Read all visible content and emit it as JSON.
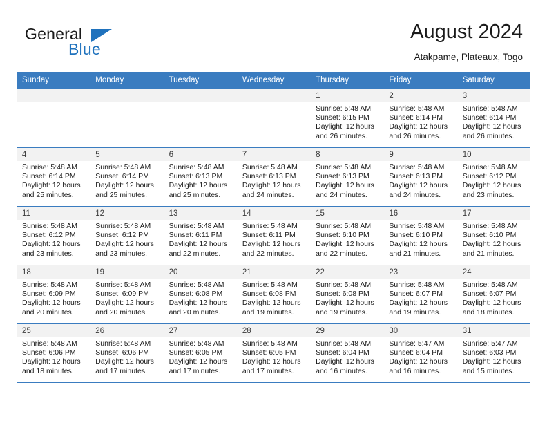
{
  "brand": {
    "word1": "General",
    "word2": "Blue",
    "flag_icon": "triangle-flag-icon"
  },
  "header": {
    "title": "August 2024",
    "subtitle": "Atakpame, Plateaux, Togo"
  },
  "colors": {
    "header_blue": "#3a7cc0",
    "brand_blue": "#1f72bd",
    "row_shade": "#f2f2f2",
    "text": "#1b1b1b"
  },
  "calendar": {
    "weekdays": [
      "Sunday",
      "Monday",
      "Tuesday",
      "Wednesday",
      "Thursday",
      "Friday",
      "Saturday"
    ],
    "weeks": [
      [
        {
          "day": "",
          "sunrise": "",
          "sunset": "",
          "daylight1": "",
          "daylight2": ""
        },
        {
          "day": "",
          "sunrise": "",
          "sunset": "",
          "daylight1": "",
          "daylight2": ""
        },
        {
          "day": "",
          "sunrise": "",
          "sunset": "",
          "daylight1": "",
          "daylight2": ""
        },
        {
          "day": "",
          "sunrise": "",
          "sunset": "",
          "daylight1": "",
          "daylight2": ""
        },
        {
          "day": "1",
          "sunrise": "Sunrise: 5:48 AM",
          "sunset": "Sunset: 6:15 PM",
          "daylight1": "Daylight: 12 hours",
          "daylight2": "and 26 minutes."
        },
        {
          "day": "2",
          "sunrise": "Sunrise: 5:48 AM",
          "sunset": "Sunset: 6:14 PM",
          "daylight1": "Daylight: 12 hours",
          "daylight2": "and 26 minutes."
        },
        {
          "day": "3",
          "sunrise": "Sunrise: 5:48 AM",
          "sunset": "Sunset: 6:14 PM",
          "daylight1": "Daylight: 12 hours",
          "daylight2": "and 26 minutes."
        }
      ],
      [
        {
          "day": "4",
          "sunrise": "Sunrise: 5:48 AM",
          "sunset": "Sunset: 6:14 PM",
          "daylight1": "Daylight: 12 hours",
          "daylight2": "and 25 minutes."
        },
        {
          "day": "5",
          "sunrise": "Sunrise: 5:48 AM",
          "sunset": "Sunset: 6:14 PM",
          "daylight1": "Daylight: 12 hours",
          "daylight2": "and 25 minutes."
        },
        {
          "day": "6",
          "sunrise": "Sunrise: 5:48 AM",
          "sunset": "Sunset: 6:13 PM",
          "daylight1": "Daylight: 12 hours",
          "daylight2": "and 25 minutes."
        },
        {
          "day": "7",
          "sunrise": "Sunrise: 5:48 AM",
          "sunset": "Sunset: 6:13 PM",
          "daylight1": "Daylight: 12 hours",
          "daylight2": "and 24 minutes."
        },
        {
          "day": "8",
          "sunrise": "Sunrise: 5:48 AM",
          "sunset": "Sunset: 6:13 PM",
          "daylight1": "Daylight: 12 hours",
          "daylight2": "and 24 minutes."
        },
        {
          "day": "9",
          "sunrise": "Sunrise: 5:48 AM",
          "sunset": "Sunset: 6:13 PM",
          "daylight1": "Daylight: 12 hours",
          "daylight2": "and 24 minutes."
        },
        {
          "day": "10",
          "sunrise": "Sunrise: 5:48 AM",
          "sunset": "Sunset: 6:12 PM",
          "daylight1": "Daylight: 12 hours",
          "daylight2": "and 23 minutes."
        }
      ],
      [
        {
          "day": "11",
          "sunrise": "Sunrise: 5:48 AM",
          "sunset": "Sunset: 6:12 PM",
          "daylight1": "Daylight: 12 hours",
          "daylight2": "and 23 minutes."
        },
        {
          "day": "12",
          "sunrise": "Sunrise: 5:48 AM",
          "sunset": "Sunset: 6:12 PM",
          "daylight1": "Daylight: 12 hours",
          "daylight2": "and 23 minutes."
        },
        {
          "day": "13",
          "sunrise": "Sunrise: 5:48 AM",
          "sunset": "Sunset: 6:11 PM",
          "daylight1": "Daylight: 12 hours",
          "daylight2": "and 22 minutes."
        },
        {
          "day": "14",
          "sunrise": "Sunrise: 5:48 AM",
          "sunset": "Sunset: 6:11 PM",
          "daylight1": "Daylight: 12 hours",
          "daylight2": "and 22 minutes."
        },
        {
          "day": "15",
          "sunrise": "Sunrise: 5:48 AM",
          "sunset": "Sunset: 6:10 PM",
          "daylight1": "Daylight: 12 hours",
          "daylight2": "and 22 minutes."
        },
        {
          "day": "16",
          "sunrise": "Sunrise: 5:48 AM",
          "sunset": "Sunset: 6:10 PM",
          "daylight1": "Daylight: 12 hours",
          "daylight2": "and 21 minutes."
        },
        {
          "day": "17",
          "sunrise": "Sunrise: 5:48 AM",
          "sunset": "Sunset: 6:10 PM",
          "daylight1": "Daylight: 12 hours",
          "daylight2": "and 21 minutes."
        }
      ],
      [
        {
          "day": "18",
          "sunrise": "Sunrise: 5:48 AM",
          "sunset": "Sunset: 6:09 PM",
          "daylight1": "Daylight: 12 hours",
          "daylight2": "and 20 minutes."
        },
        {
          "day": "19",
          "sunrise": "Sunrise: 5:48 AM",
          "sunset": "Sunset: 6:09 PM",
          "daylight1": "Daylight: 12 hours",
          "daylight2": "and 20 minutes."
        },
        {
          "day": "20",
          "sunrise": "Sunrise: 5:48 AM",
          "sunset": "Sunset: 6:08 PM",
          "daylight1": "Daylight: 12 hours",
          "daylight2": "and 20 minutes."
        },
        {
          "day": "21",
          "sunrise": "Sunrise: 5:48 AM",
          "sunset": "Sunset: 6:08 PM",
          "daylight1": "Daylight: 12 hours",
          "daylight2": "and 19 minutes."
        },
        {
          "day": "22",
          "sunrise": "Sunrise: 5:48 AM",
          "sunset": "Sunset: 6:08 PM",
          "daylight1": "Daylight: 12 hours",
          "daylight2": "and 19 minutes."
        },
        {
          "day": "23",
          "sunrise": "Sunrise: 5:48 AM",
          "sunset": "Sunset: 6:07 PM",
          "daylight1": "Daylight: 12 hours",
          "daylight2": "and 19 minutes."
        },
        {
          "day": "24",
          "sunrise": "Sunrise: 5:48 AM",
          "sunset": "Sunset: 6:07 PM",
          "daylight1": "Daylight: 12 hours",
          "daylight2": "and 18 minutes."
        }
      ],
      [
        {
          "day": "25",
          "sunrise": "Sunrise: 5:48 AM",
          "sunset": "Sunset: 6:06 PM",
          "daylight1": "Daylight: 12 hours",
          "daylight2": "and 18 minutes."
        },
        {
          "day": "26",
          "sunrise": "Sunrise: 5:48 AM",
          "sunset": "Sunset: 6:06 PM",
          "daylight1": "Daylight: 12 hours",
          "daylight2": "and 17 minutes."
        },
        {
          "day": "27",
          "sunrise": "Sunrise: 5:48 AM",
          "sunset": "Sunset: 6:05 PM",
          "daylight1": "Daylight: 12 hours",
          "daylight2": "and 17 minutes."
        },
        {
          "day": "28",
          "sunrise": "Sunrise: 5:48 AM",
          "sunset": "Sunset: 6:05 PM",
          "daylight1": "Daylight: 12 hours",
          "daylight2": "and 17 minutes."
        },
        {
          "day": "29",
          "sunrise": "Sunrise: 5:48 AM",
          "sunset": "Sunset: 6:04 PM",
          "daylight1": "Daylight: 12 hours",
          "daylight2": "and 16 minutes."
        },
        {
          "day": "30",
          "sunrise": "Sunrise: 5:47 AM",
          "sunset": "Sunset: 6:04 PM",
          "daylight1": "Daylight: 12 hours",
          "daylight2": "and 16 minutes."
        },
        {
          "day": "31",
          "sunrise": "Sunrise: 5:47 AM",
          "sunset": "Sunset: 6:03 PM",
          "daylight1": "Daylight: 12 hours",
          "daylight2": "and 15 minutes."
        }
      ]
    ]
  }
}
